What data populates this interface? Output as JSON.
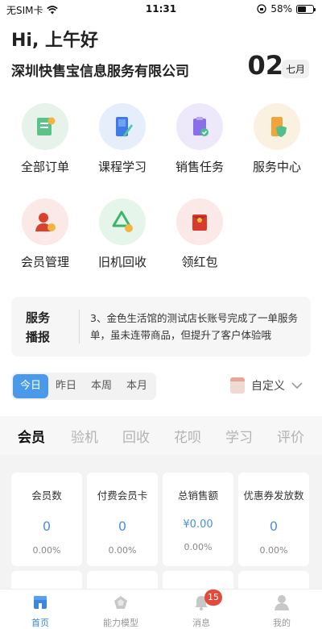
{
  "status_bar": {
    "carrier": "无SIM卡",
    "time": "11:31",
    "battery": "58%",
    "battery_level": 0.58
  },
  "header": {
    "greeting": "Hi, 上午好",
    "company": "深圳快售宝信息服务有限公司",
    "day": "02",
    "month": "七月"
  },
  "menu": [
    {
      "label": "全部订单",
      "icon": "orders-icon"
    },
    {
      "label": "课程学习",
      "icon": "course-icon"
    },
    {
      "label": "销售任务",
      "icon": "sales-task-icon"
    },
    {
      "label": "服务中心",
      "icon": "service-center-icon"
    },
    {
      "label": "会员管理",
      "icon": "member-icon"
    },
    {
      "label": "旧机回收",
      "icon": "recycle-icon"
    },
    {
      "label": "领红包",
      "icon": "red-packet-icon"
    }
  ],
  "news": {
    "tag": "服务播报",
    "text": "3、金色生活馆的测试店长账号完成了一单服务单，虽未连带商品，但提升了客户体验哦"
  },
  "period": {
    "options": [
      "今日",
      "昨日",
      "本周",
      "本月"
    ],
    "selected": "今日",
    "custom": "自定义"
  },
  "categories": {
    "tabs": [
      "会员",
      "验机",
      "回收",
      "花呗",
      "学习",
      "评价"
    ],
    "selected": "会员"
  },
  "stats": [
    {
      "title": "会员数",
      "value": "0",
      "pct": "0.00%"
    },
    {
      "title": "付费会员卡",
      "value": "0",
      "pct": "0.00%"
    },
    {
      "title": "总销售额",
      "value": "¥0.00",
      "pct": "0.00%"
    },
    {
      "title": "优惠券发放数",
      "value": "0",
      "pct": "0.00%"
    }
  ],
  "tabbar": {
    "items": [
      {
        "label": "首页",
        "icon": "home-icon"
      },
      {
        "label": "能力模型",
        "icon": "ability-model-icon"
      },
      {
        "label": "消息",
        "icon": "bell-icon"
      },
      {
        "label": "我的",
        "icon": "profile-icon"
      }
    ],
    "selected": "首页",
    "message_badge": "15"
  },
  "colors": {
    "accent": "#4a9ae9",
    "badge": "#e24a3c"
  }
}
